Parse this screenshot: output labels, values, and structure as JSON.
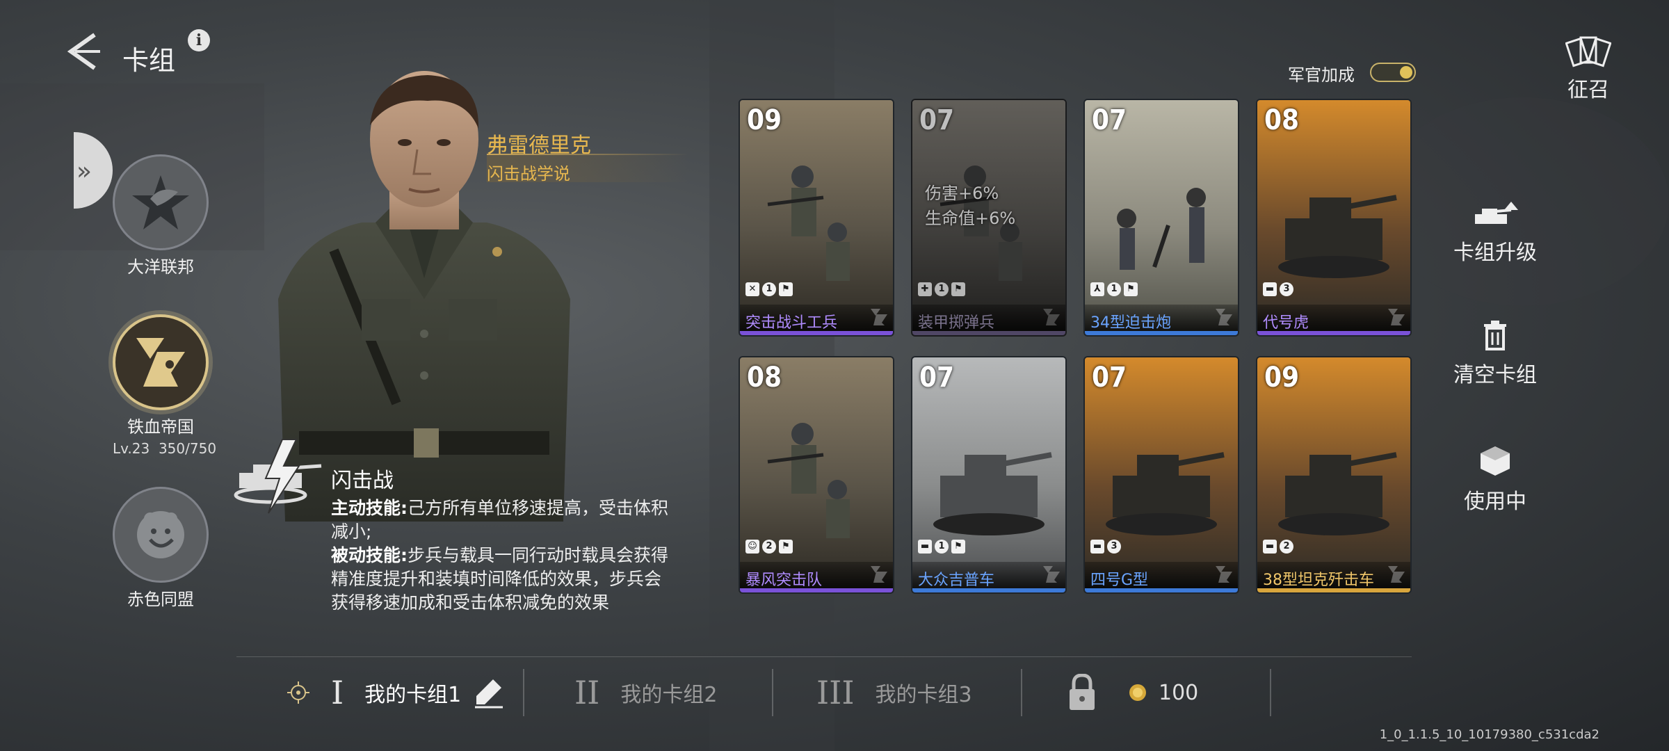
{
  "header": {
    "title": "卡组",
    "back_icon": "back-arrow-icon",
    "info_icon": "info-icon",
    "info_glyph": "i"
  },
  "factions": [
    {
      "name": "大洋联邦",
      "active": false
    },
    {
      "name": "铁血帝国",
      "active": true,
      "level": "Lv.23",
      "exp": "350/750"
    },
    {
      "name": "赤色同盟",
      "active": false
    }
  ],
  "commander": {
    "name": "弗雷德里克",
    "doctrine": "闪击战学说"
  },
  "skill": {
    "name": "闪击战",
    "active_label": "主动技能:",
    "active_text": "己方所有单位移速提高，受击体积减小;",
    "passive_label": "被动技能:",
    "passive_text": "步兵与载具一同行动时载具会获得精准度提升和装填时间降低的效果，步兵会获得移速加成和受击体积减免的效果"
  },
  "officer_bonus": {
    "label": "军官加成",
    "enabled": true
  },
  "cards": [
    {
      "cost": "09",
      "name": "突击战斗工兵",
      "rarity_color": "#7a52d8",
      "name_color": "#b08cff",
      "count": "1",
      "kind": "infantry",
      "icons": [
        "✕",
        "1",
        "⚑"
      ],
      "dim": false
    },
    {
      "cost": "07",
      "name": "装甲掷弹兵",
      "rarity_color": "#7a52d8",
      "name_color": "#b08cff",
      "count": "1",
      "kind": "infantry",
      "icons": [
        "✚",
        "1",
        "⚑"
      ],
      "dim": true,
      "buffs": [
        "伤害+6%",
        "生命值+6%"
      ]
    },
    {
      "cost": "07",
      "name": "34型迫击炮",
      "rarity_color": "#3d7ad8",
      "name_color": "#6aa4ff",
      "count": "1",
      "kind": "artillery",
      "icons": [
        "⅄",
        "1",
        "⚑"
      ],
      "dim": false
    },
    {
      "cost": "08",
      "name": "代号虎",
      "rarity_color": "#7a52d8",
      "name_color": "#b08cff",
      "count": "3",
      "kind": "tank",
      "icons": [
        "▬",
        "3"
      ],
      "dim": false
    },
    {
      "cost": "08",
      "name": "暴风突击队",
      "rarity_color": "#7a52d8",
      "name_color": "#b08cff",
      "count": "2",
      "kind": "infantry",
      "icons": [
        "☺",
        "2",
        "⚑"
      ],
      "dim": false
    },
    {
      "cost": "07",
      "name": "大众吉普车",
      "rarity_color": "#3d7ad8",
      "name_color": "#6aa4ff",
      "count": "1",
      "kind": "vehicle",
      "icons": [
        "▬",
        "1",
        "⚑"
      ],
      "dim": false
    },
    {
      "cost": "07",
      "name": "四号G型",
      "rarity_color": "#3d7ad8",
      "name_color": "#6aa4ff",
      "count": "3",
      "kind": "tank",
      "icons": [
        "▬",
        "3"
      ],
      "dim": false
    },
    {
      "cost": "09",
      "name": "38型坦克歼击车",
      "rarity_color": "#d8a53d",
      "name_color": "#f0c66a",
      "count": "2",
      "kind": "tank",
      "icons": [
        "▬",
        "2"
      ],
      "dim": false
    }
  ],
  "side_menu": {
    "recruit": "征召",
    "upgrade": "卡组升级",
    "clear": "清空卡组",
    "in_use": "使用中"
  },
  "deck_tabs": [
    {
      "roman": "I",
      "label": "我的卡组1",
      "selected": true
    },
    {
      "roman": "II",
      "label": "我的卡组2",
      "selected": false
    },
    {
      "roman": "III",
      "label": "我的卡组3",
      "selected": false
    }
  ],
  "locked_slot": {
    "cost": "100"
  },
  "version": "1_0_1.1.5_10_10179380_c531cda2"
}
